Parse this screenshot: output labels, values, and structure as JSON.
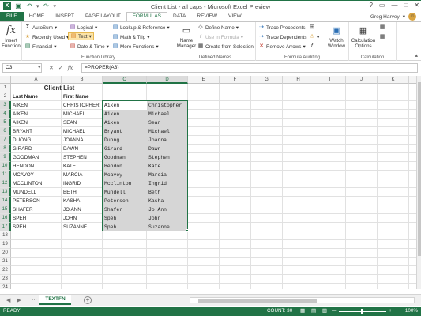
{
  "window": {
    "title": "Client List - all caps - Microsoft Excel Preview",
    "controls": [
      "?",
      "▭",
      "—",
      "□",
      "✕"
    ]
  },
  "ribbon": {
    "tabs": [
      "FILE",
      "HOME",
      "INSERT",
      "PAGE LAYOUT",
      "FORMULAS",
      "DATA",
      "REVIEW",
      "VIEW"
    ],
    "active_tab": "FORMULAS",
    "user": "Greg Harvey",
    "insert_function": "Insert Function",
    "function_library": {
      "label": "Function Library",
      "autosum": "AutoSum",
      "recently_used": "Recently Used",
      "financial": "Financial",
      "logical": "Logical",
      "text": "Text",
      "date_time": "Date & Time",
      "lookup": "Lookup & Reference",
      "math": "Math & Trig",
      "more": "More Functions"
    },
    "defined_names": {
      "label": "Defined Names",
      "name_manager": "Name Manager",
      "define_name": "Define Name",
      "use_in_formula": "Use in Formula",
      "create_from_selection": "Create from Selection"
    },
    "formula_auditing": {
      "label": "Formula Auditing",
      "trace_precedents": "Trace Precedents",
      "trace_dependents": "Trace Dependents",
      "remove_arrows": "Remove Arrows",
      "watch_window": "Watch Window"
    },
    "calculation": {
      "label": "Calculation",
      "options": "Calculation Options"
    }
  },
  "formula_bar": {
    "name_box": "C3",
    "formula": "=PROPER(A3)"
  },
  "columns": [
    "A",
    "B",
    "C",
    "D",
    "E",
    "F",
    "G",
    "H",
    "I",
    "J",
    "K",
    "L"
  ],
  "selected_columns": [
    "C",
    "D"
  ],
  "rows": [
    "1",
    "2",
    "3",
    "4",
    "5",
    "6",
    "7",
    "8",
    "9",
    "10",
    "11",
    "12",
    "13",
    "14",
    "15",
    "16",
    "17",
    "18",
    "19",
    "20",
    "21",
    "22",
    "23",
    "24"
  ],
  "sheet": {
    "title": "Client List",
    "headers": [
      "Last Name",
      "First Name"
    ],
    "data": [
      [
        "AIKEN",
        "CHRISTOPHER",
        "Aiken",
        "Christopher"
      ],
      [
        "AIKEN",
        "MICHAEL",
        "Aiken",
        "Michael"
      ],
      [
        "AIKEN",
        "SEAN",
        "Aiken",
        "Sean"
      ],
      [
        "BRYANT",
        "MICHAEL",
        "Bryant",
        "Michael"
      ],
      [
        "DUONG",
        "JOANNA",
        "Duong",
        "Joanna"
      ],
      [
        "GIRARD",
        "DAWN",
        "Girard",
        "Dawn"
      ],
      [
        "GOODMAN",
        "STEPHEN",
        "Goodman",
        "Stephen"
      ],
      [
        "HENDON",
        "KATE",
        "Hendon",
        "Kate"
      ],
      [
        "MCAVOY",
        "MARCIA",
        "Mcavoy",
        "Marcia"
      ],
      [
        "MCCLINTON",
        "INGRID",
        "Mcclinton",
        "Ingrid"
      ],
      [
        "MUNDELL",
        "BETH",
        "Mundell",
        "Beth"
      ],
      [
        "PETERSON",
        "KASHA",
        "Peterson",
        "Kasha"
      ],
      [
        "SHAFER",
        "JO ANN",
        "Shafer",
        "Jo Ann"
      ],
      [
        "SPEH",
        "JOHN",
        "Speh",
        "John"
      ],
      [
        "SPEH",
        "SUZANNE",
        "Speh",
        "Suzanne"
      ]
    ]
  },
  "sheet_tab": "TEXTFN",
  "status": {
    "ready": "READY",
    "count": "COUNT: 30",
    "zoom": "100%"
  },
  "colors": {
    "accent": "#217346",
    "selection": "#d6d6d6"
  }
}
